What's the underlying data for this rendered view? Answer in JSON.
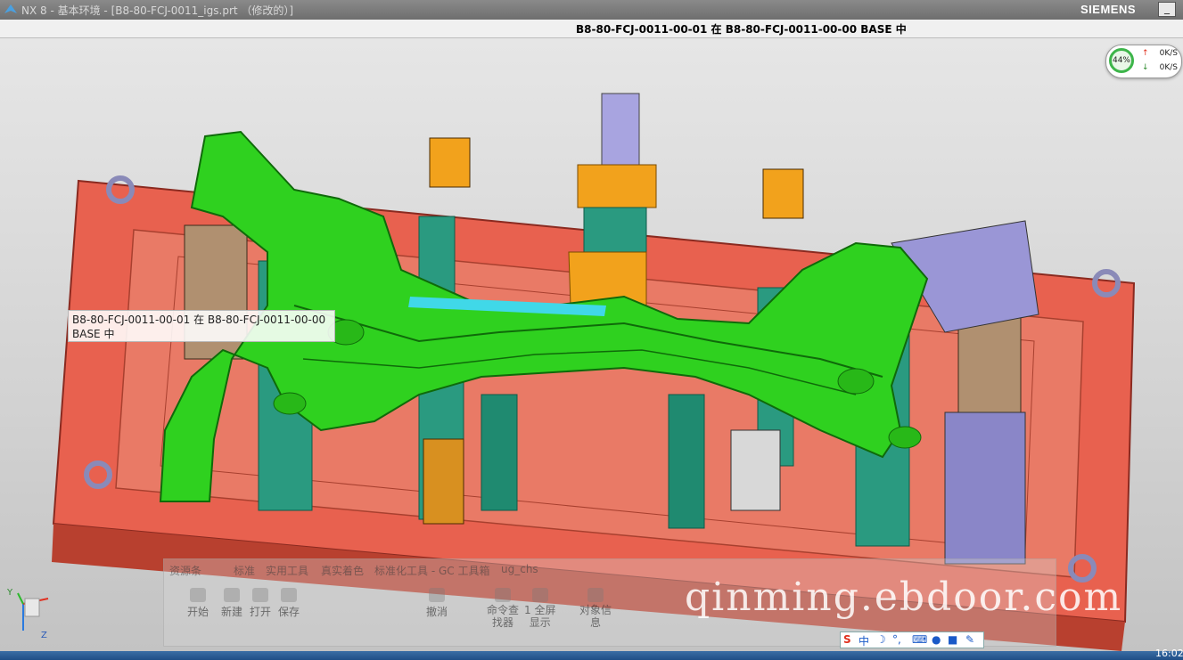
{
  "window": {
    "title": "NX 8 - 基本环境 - [B8-80-FCJ-0011_igs.prt （修改的）]",
    "brand": "SIEMENS",
    "min_label": "_"
  },
  "status": {
    "message": "B8-80-FCJ-0011-00-01 在 B8-80-FCJ-0011-00-00 BASE 中"
  },
  "netmon": {
    "percent": "44%",
    "upload_arrow": "↑",
    "upload": "0K/S",
    "download_arrow": "↓",
    "download": "0K/S"
  },
  "tooltip": {
    "line1": "B8-80-FCJ-0011-00-01 在 B8-80-FCJ-0011-00-00",
    "line2": "BASE 中"
  },
  "ribbon": {
    "tabs": [
      "资源条",
      "标准",
      "实用工具",
      "真实着色",
      "标准化工具 - GC 工具箱",
      "ug_chs"
    ],
    "buttons": {
      "start": "开始",
      "new": "新建",
      "open": "打开",
      "save": "保存",
      "undo": "撤消",
      "command_finder_1": "命令查",
      "command_finder_2": "找器",
      "fullscreen_1": "1 全屏",
      "fullscreen_2": "显示",
      "object_info_1": "对象信",
      "object_info_2": "息"
    }
  },
  "watermark": "qinming.ebdoor.com",
  "ime": {
    "logo": "S",
    "lang": "中"
  },
  "triad": {
    "y": "Y",
    "z": "Z"
  },
  "taskbar": {
    "clock": "16:02"
  },
  "colors": {
    "fixture_base": "#e8614f",
    "part_green": "#2fd11f",
    "clamp_teal": "#2a9a80",
    "clamp_purple": "#9a96d6",
    "clamp_orange": "#f2a21c"
  }
}
